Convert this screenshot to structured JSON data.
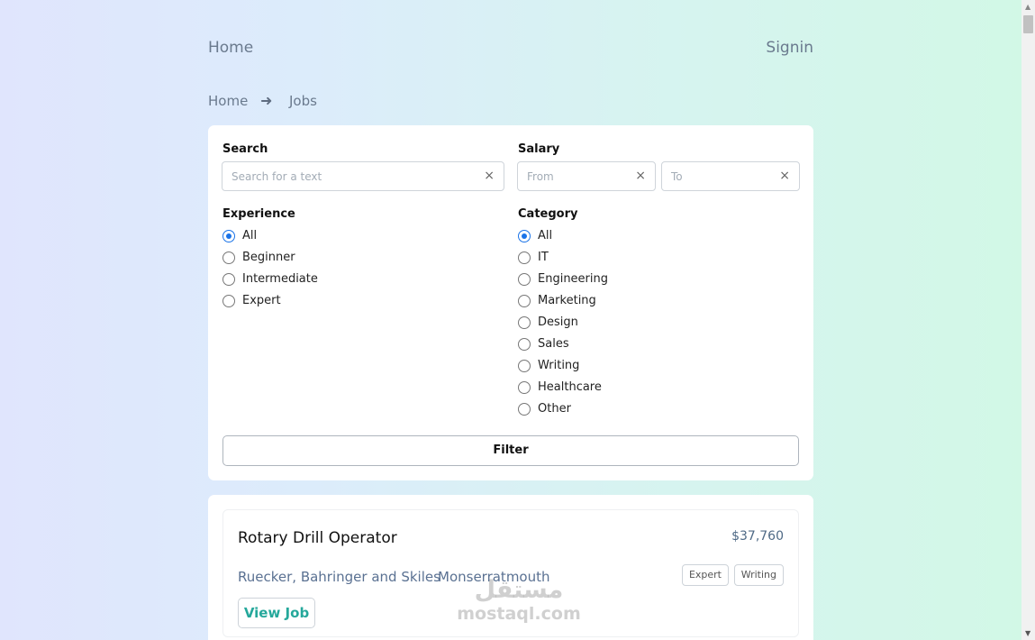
{
  "nav": {
    "home": "Home",
    "signin": "Signin"
  },
  "breadcrumb": {
    "home": "Home",
    "separator": "➜",
    "current": "Jobs"
  },
  "filters": {
    "search_label": "Search",
    "search_placeholder": "Search for a text",
    "salary_label": "Salary",
    "salary_from_placeholder": "From",
    "salary_to_placeholder": "To",
    "clear_icon": "×",
    "experience_label": "Experience",
    "experience_options": [
      "All",
      "Beginner",
      "Intermediate",
      "Expert"
    ],
    "experience_selected": "All",
    "category_label": "Category",
    "category_options": [
      "All",
      "IT",
      "Engineering",
      "Marketing",
      "Design",
      "Sales",
      "Writing",
      "Healthcare",
      "Other"
    ],
    "category_selected": "All",
    "filter_button": "Filter"
  },
  "jobs": [
    {
      "title": "Rotary Drill Operator",
      "salary": "$37,760",
      "company": "Ruecker, Bahringer and Skiles",
      "location": "Monserratmouth",
      "tags": [
        "Expert",
        "Writing"
      ],
      "view_label": "View Job"
    }
  ],
  "watermark": {
    "logo": "مستقل",
    "text": "mostaql.com"
  },
  "colors": {
    "accent": "#1a73e8",
    "view_button": "#25a89b",
    "muted_text": "#6a7a8e"
  }
}
